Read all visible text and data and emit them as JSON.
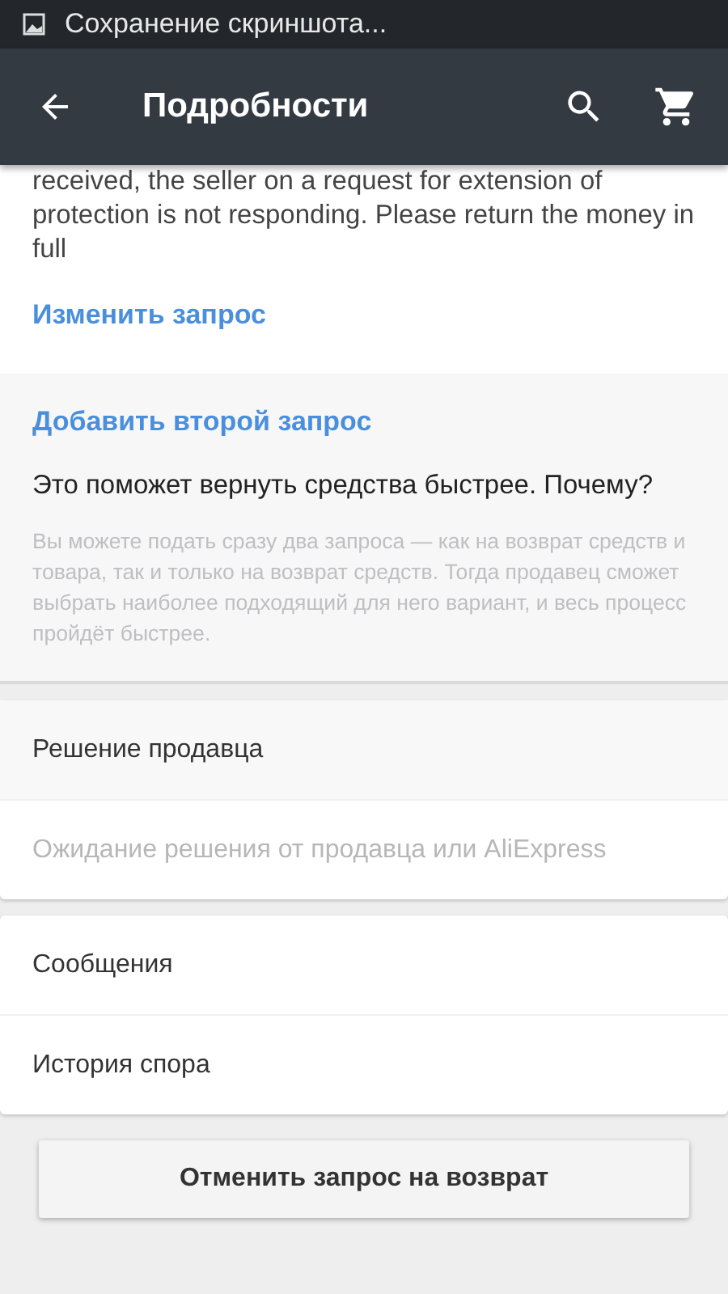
{
  "status_bar": {
    "notification": "Сохранение скриншота..."
  },
  "app_bar": {
    "title": "Подробности"
  },
  "request": {
    "text": "received, the seller on a request for extension of protection is not responding. Please return the money in full",
    "edit_link": "Изменить запрос"
  },
  "second_request": {
    "link": "Добавить второй запрос",
    "headline": "Это поможет вернуть средства быстрее. Почему?",
    "description": "Вы можете подать сразу два запроса — как на возврат средств и товара, так и только на возврат средств. Тогда продавец сможет выбрать наиболее подходящий для него вариант, и весь процесс пройдёт быстрее."
  },
  "seller_decision": {
    "title": "Решение продавца",
    "status": "Ожидание решения от продавца или AliExpress"
  },
  "menu_items": [
    "Сообщения",
    "История спора"
  ],
  "cancel_button": "Отменить запрос на возврат"
}
